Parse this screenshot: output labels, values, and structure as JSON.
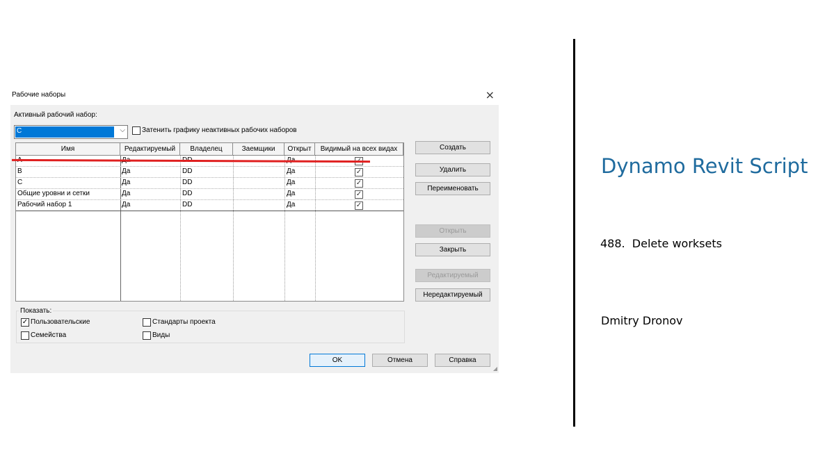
{
  "dialog": {
    "title": "Рабочие наборы",
    "close_icon": "×",
    "active_label": "Активный рабочий набор:",
    "active_value": "C",
    "gray_out_label": "Затенить графику неактивных рабочих наборов",
    "columns": [
      "Имя",
      "Редактируемый",
      "Владелец",
      "Заемщики",
      "Открыт",
      "Видимый на всех видах"
    ],
    "rows": [
      {
        "name": "A",
        "editable": "Да",
        "owner": "DD",
        "borrowers": "",
        "open": "Да",
        "visible": true
      },
      {
        "name": "B",
        "editable": "Да",
        "owner": "DD",
        "borrowers": "",
        "open": "Да",
        "visible": true
      },
      {
        "name": "C",
        "editable": "Да",
        "owner": "DD",
        "borrowers": "",
        "open": "Да",
        "visible": true
      },
      {
        "name": "Общие уровни и сетки",
        "editable": "Да",
        "owner": "DD",
        "borrowers": "",
        "open": "Да",
        "visible": true
      },
      {
        "name": "Рабочий набор 1",
        "editable": "Да",
        "owner": "DD",
        "borrowers": "",
        "open": "Да",
        "visible": true
      }
    ],
    "buttons": {
      "create": "Создать",
      "delete": "Удалить",
      "rename": "Переименовать",
      "open": "Открыть",
      "close": "Закрыть",
      "editable": "Редактируемый",
      "non_editable": "Нередактируемый",
      "ok": "OK",
      "cancel": "Отмена",
      "help": "Справка"
    },
    "show": {
      "label": "Показать:",
      "user": "Пользовательские",
      "families": "Семейства",
      "standards": "Стандарты проекта",
      "views": "Виды"
    }
  },
  "slide": {
    "title": "Dynamo Revit Script",
    "subtitle": "488.  Delete worksets",
    "author": "Dmitry Dronov"
  },
  "colors": {
    "accent": "#1f6b9e",
    "strike": "#e02020",
    "selection": "#0078d7"
  }
}
